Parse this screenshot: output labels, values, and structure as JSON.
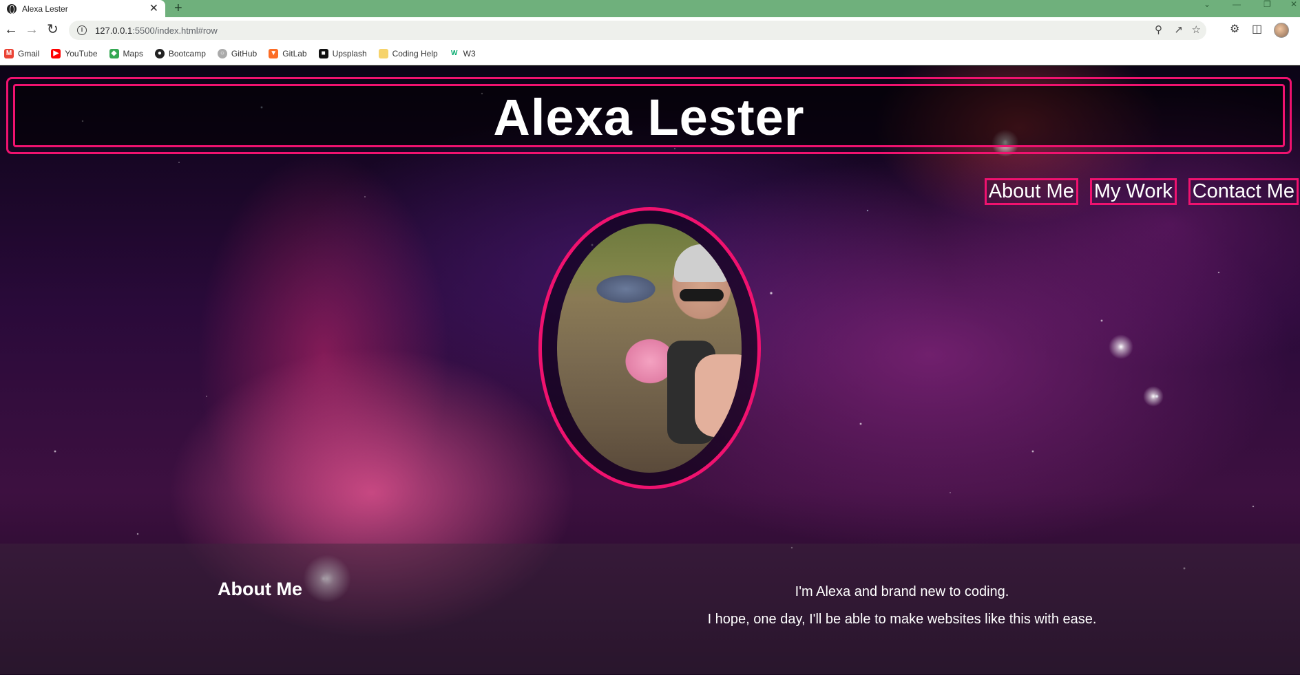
{
  "browser": {
    "tab_title": "Alexa Lester",
    "tab_close": "✕",
    "new_tab": "+",
    "url_host": "127.0.0.1",
    "url_rest": ":5500/index.html#row",
    "window_controls": [
      "⌄",
      "—",
      "❐",
      "✕"
    ]
  },
  "bookmarks": [
    {
      "label": "Gmail",
      "icon": "gmail-icon",
      "color": "#ea4335",
      "glyph": "M"
    },
    {
      "label": "YouTube",
      "icon": "youtube-icon",
      "color": "#ff0000",
      "glyph": "▶"
    },
    {
      "label": "Maps",
      "icon": "maps-icon",
      "color": "#34a853",
      "glyph": "◆"
    },
    {
      "label": "Bootcamp",
      "icon": "bootcamp-icon",
      "color": "#222222",
      "glyph": "●"
    },
    {
      "label": "GitHub",
      "icon": "github-icon",
      "color": "#777777",
      "glyph": "○"
    },
    {
      "label": "GitLab",
      "icon": "gitlab-icon",
      "color": "#fc6d26",
      "glyph": "▼"
    },
    {
      "label": "Upsplash",
      "icon": "unsplash-icon",
      "color": "#111111",
      "glyph": "■"
    },
    {
      "label": "Coding Help",
      "icon": "folder-icon",
      "color": "#f6d36b",
      "glyph": ""
    },
    {
      "label": "W3",
      "icon": "w3-icon",
      "color": "#04aa6d",
      "glyph": "W"
    }
  ],
  "page": {
    "title": "Alexa Lester",
    "nav": [
      "About Me",
      "My Work",
      "Contact Me"
    ],
    "about": {
      "heading": "About Me",
      "line1": "I'm Alexa and brand new to coding.",
      "line2": "I hope, one day, I'll be able to make websites like this with ease."
    }
  },
  "colors": {
    "accent": "#f0126f",
    "tabstrip": "#6fb07c"
  }
}
